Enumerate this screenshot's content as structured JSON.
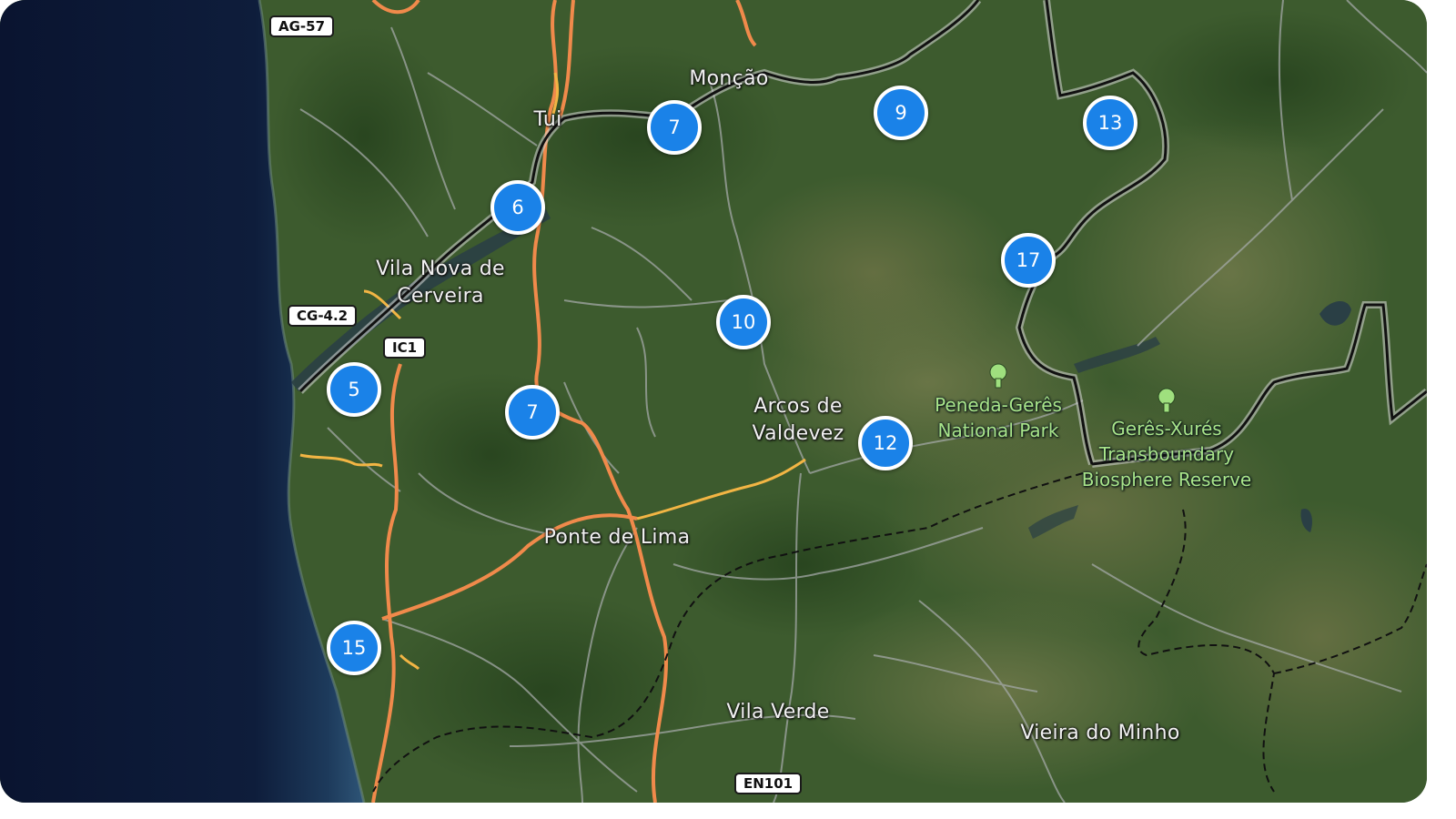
{
  "map": {
    "clusters": [
      {
        "id": "cluster-1",
        "count": "7"
      },
      {
        "id": "cluster-2",
        "count": "9"
      },
      {
        "id": "cluster-3",
        "count": "13"
      },
      {
        "id": "cluster-4",
        "count": "6"
      },
      {
        "id": "cluster-5",
        "count": "17"
      },
      {
        "id": "cluster-6",
        "count": "10"
      },
      {
        "id": "cluster-7",
        "count": "5"
      },
      {
        "id": "cluster-8",
        "count": "7"
      },
      {
        "id": "cluster-9",
        "count": "12"
      },
      {
        "id": "cluster-10",
        "count": "15"
      }
    ],
    "places": [
      {
        "id": "monca",
        "name": "Monção"
      },
      {
        "id": "tui",
        "name": "Tui"
      },
      {
        "id": "vila-nova-de-cerveira",
        "name": "Vila Nova de\nCerveira"
      },
      {
        "id": "arcos-de-valdevez",
        "name": "Arcos de\nValdevez"
      },
      {
        "id": "ponte-de-lima",
        "name": "Ponte de Lima"
      },
      {
        "id": "vila-verde",
        "name": "Vila Verde"
      },
      {
        "id": "vieira-do-minho",
        "name": "Vieira do Minho"
      }
    ],
    "pois": [
      {
        "id": "peneda-geres",
        "name": "Peneda-Gerês\nNational Park",
        "icon": "tree-icon"
      },
      {
        "id": "geres-xures",
        "name": "Gerês-Xurés\nTransboundary\nBiosphere Reserve",
        "icon": "tree-icon"
      }
    ],
    "road_shields": [
      {
        "id": "ag-57",
        "label": "AG-57"
      },
      {
        "id": "cg-4-2",
        "label": "CG-4.2"
      },
      {
        "id": "ic1",
        "label": "IC1"
      },
      {
        "id": "en101",
        "label": "EN101"
      }
    ],
    "colors": {
      "cluster_fill": "#1a82e8",
      "cluster_border": "#ffffff",
      "ocean": "#0c1730",
      "land": "#3b5a2c",
      "motorway": "#f08a4b",
      "trunk": "#f2b544",
      "border": "#111111",
      "poi_text": "#a9e58a"
    }
  }
}
